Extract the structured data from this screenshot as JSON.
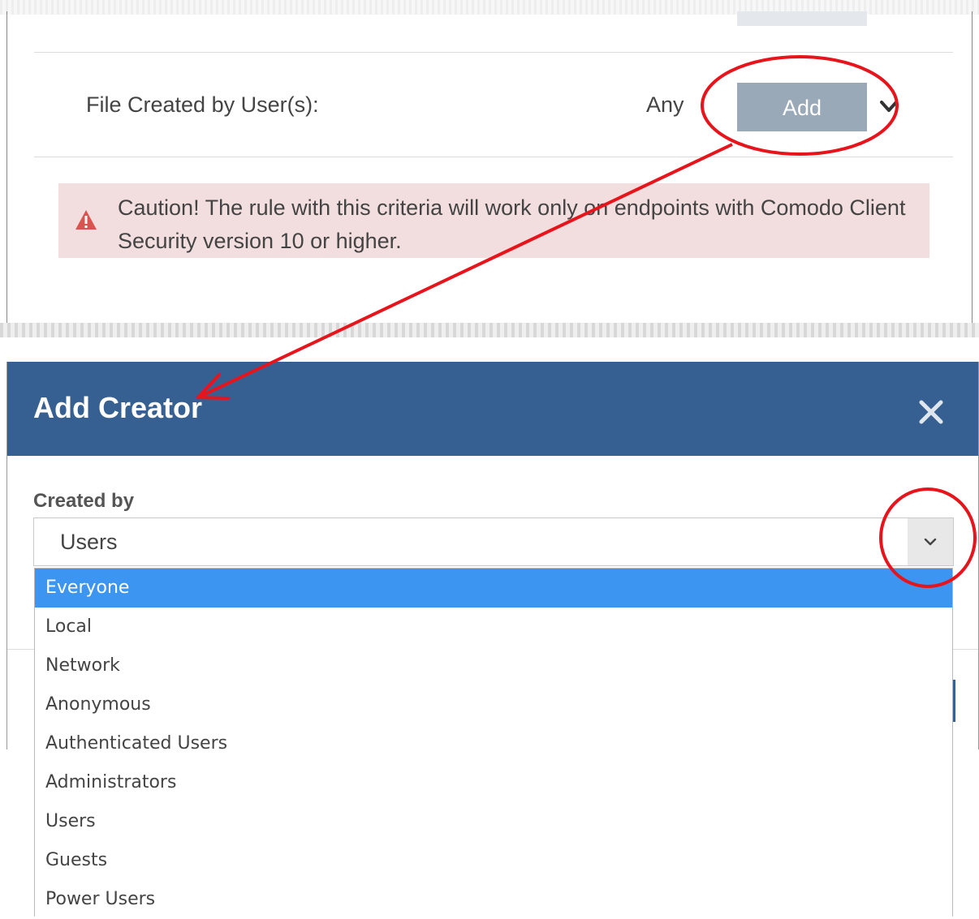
{
  "rule_panel": {
    "field_label": "File Created by User(s):",
    "current_value": "Any",
    "add_button_label": "Add",
    "caution_text": "Caution! The rule with this criteria will work only on endpoints with Comodo Client Security version 10 or higher."
  },
  "dialog": {
    "title": "Add Creator",
    "created_by_label": "Created by",
    "selected_value": "Users",
    "options": [
      "Everyone",
      "Local",
      "Network",
      "Anonymous",
      "Authenticated Users",
      "Administrators",
      "Users",
      "Guests",
      "Power Users"
    ],
    "highlighted_option": "Everyone"
  },
  "colors": {
    "header": "#376092",
    "add_button": "#9aa9b7",
    "caution_bg": "#f2dede",
    "caution_icon": "#d9534f",
    "highlight": "#3d95f2",
    "annotation": "#e8141b"
  }
}
